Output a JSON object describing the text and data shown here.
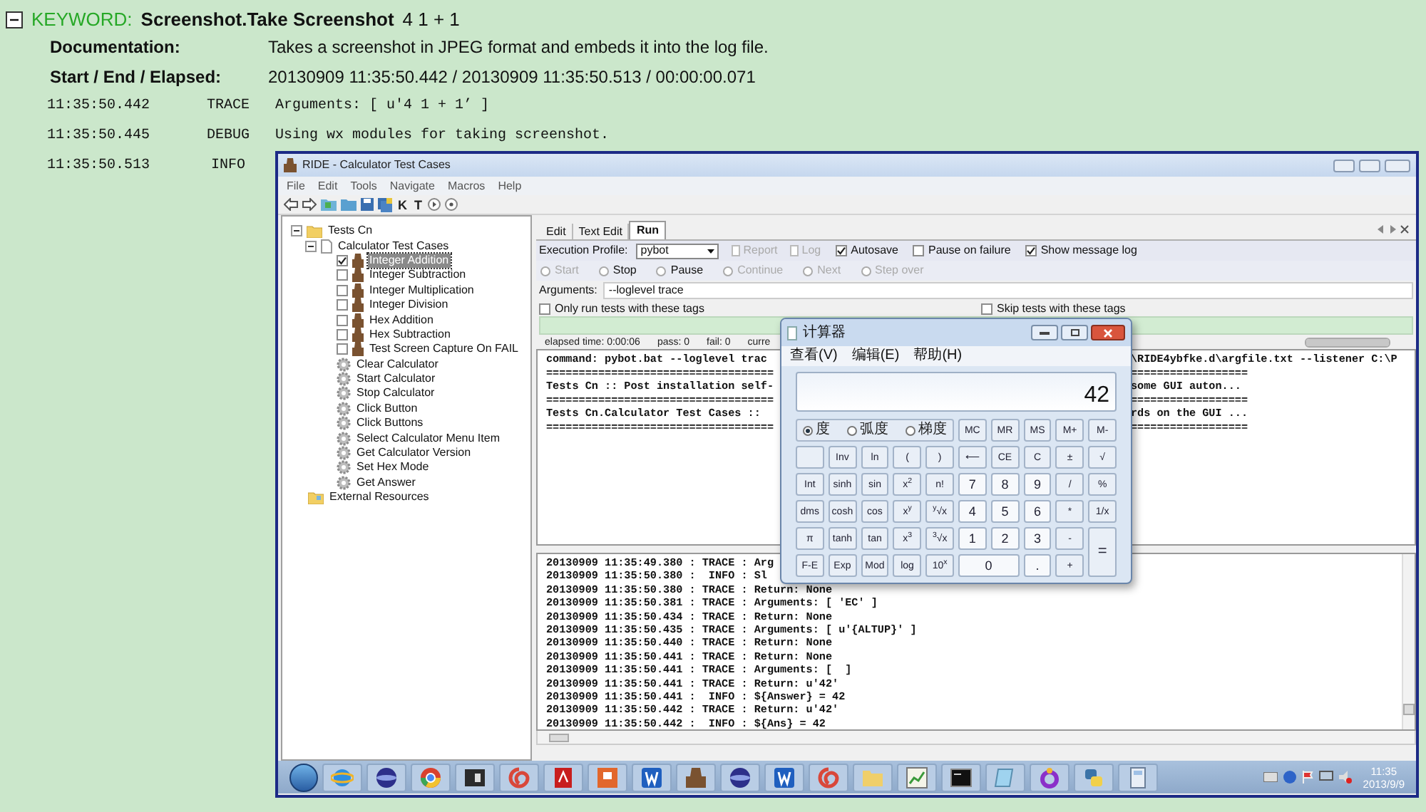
{
  "keyword": {
    "label": "KEYWORD:",
    "name": "Screenshot.Take Screenshot",
    "args": "4 1 + 1",
    "expanded": true
  },
  "details": [
    {
      "label": "Documentation:",
      "value": "Takes a screenshot in JPEG format and embeds it into the log file."
    },
    {
      "label": "Start / End / Elapsed:",
      "value": "20130909 11:35:50.442 / 20130909 11:35:50.513 / 00:00:00.071"
    }
  ],
  "messages": [
    {
      "time": "11:35:50.442",
      "level": "TRACE",
      "kind": "text",
      "text": "Arguments: [ u'4 1 + 1’ ]"
    },
    {
      "time": "11:35:50.445",
      "level": "DEBUG",
      "kind": "text",
      "text": "Using wx modules for taking screenshot."
    },
    {
      "time": "11:35:50.513",
      "level": "INFO",
      "kind": "screenshot"
    }
  ],
  "screenshot": {
    "window_title": "RIDE - Calculator Test Cases",
    "menu": [
      "File",
      "Edit",
      "Tools",
      "Navigate",
      "Macros",
      "Help"
    ],
    "toolbar": [
      {
        "kind": "back"
      },
      {
        "kind": "forward"
      },
      {
        "kind": "open-suite"
      },
      {
        "kind": "folder"
      },
      {
        "kind": "save"
      },
      {
        "kind": "save-all"
      },
      {
        "kind": "letter",
        "glyph": "K"
      },
      {
        "kind": "letter",
        "glyph": "T"
      },
      {
        "kind": "play"
      },
      {
        "kind": "stop"
      }
    ],
    "tree": [
      {
        "label": "Tests Cn",
        "kind": "folder",
        "expanded": true,
        "selected": false,
        "children": [
          {
            "label": "Calculator Test Cases",
            "kind": "file",
            "expanded": true,
            "selected": false,
            "children": [
              {
                "label": "Integer Addition",
                "kind": "test",
                "checked": true,
                "selected": true
              },
              {
                "label": "Integer Subtraction",
                "kind": "test",
                "checked": false,
                "selected": false
              },
              {
                "label": "Integer Multiplication",
                "kind": "test",
                "checked": false,
                "selected": false
              },
              {
                "label": "Integer Division",
                "kind": "test",
                "checked": false,
                "selected": false
              },
              {
                "label": "Hex Addition",
                "kind": "test",
                "checked": false,
                "selected": false
              },
              {
                "label": "Hex Subtraction",
                "kind": "test",
                "checked": false,
                "selected": false
              },
              {
                "label": "Test Screen Capture On FAIL",
                "kind": "test",
                "checked": false,
                "selected": false
              },
              {
                "label": "Clear Calculator",
                "kind": "keyword",
                "selected": false
              },
              {
                "label": "Start Calculator",
                "kind": "keyword",
                "selected": false
              },
              {
                "label": "Stop Calculator",
                "kind": "keyword",
                "selected": false
              },
              {
                "label": "Click Button",
                "kind": "keyword",
                "selected": false
              },
              {
                "label": "Click Buttons",
                "kind": "keyword",
                "selected": false
              },
              {
                "label": "Select Calculator Menu Item",
                "kind": "keyword",
                "selected": false
              },
              {
                "label": "Get Calculator Version",
                "kind": "keyword",
                "selected": false
              },
              {
                "label": "Set Hex Mode",
                "kind": "keyword",
                "selected": false
              },
              {
                "label": "Get Answer",
                "kind": "keyword",
                "selected": false
              }
            ]
          }
        ]
      },
      {
        "label": "External Resources",
        "kind": "resource",
        "selected": false
      }
    ],
    "tabs": [
      {
        "label": "Edit",
        "selected": false
      },
      {
        "label": "Text Edit",
        "selected": false
      },
      {
        "label": "Run",
        "selected": true
      }
    ],
    "profile": {
      "label": "Execution Profile:",
      "value": "pybot"
    },
    "reports": [
      {
        "label": "Report",
        "disabled": true
      },
      {
        "label": "Log",
        "disabled": true
      }
    ],
    "options": [
      {
        "label": "Autosave",
        "checked": true
      },
      {
        "label": "Pause on failure",
        "checked": false
      },
      {
        "label": "Show message log",
        "checked": true
      }
    ],
    "controls": [
      {
        "label": "Start",
        "disabled": true
      },
      {
        "label": "Stop",
        "disabled": false
      },
      {
        "label": "Pause",
        "disabled": false
      },
      {
        "label": "Continue",
        "disabled": true
      },
      {
        "label": "Next",
        "disabled": true
      },
      {
        "label": "Step over",
        "disabled": true
      }
    ],
    "arguments": {
      "label": "Arguments:",
      "value": "--loglevel trace"
    },
    "tag_filters": [
      {
        "label": "Only run tests with these tags",
        "checked": false
      },
      {
        "label": "Skip tests with these tags",
        "checked": false
      }
    ],
    "status": [
      "elapsed time: 0:00:06",
      "pass: 0",
      "fail: 0",
      "curre"
    ],
    "progress": {
      "level": 1
    },
    "console": [
      {
        "left": "command: pybot.bat --loglevel trac",
        "right": "\\RIDE4ybfke.d\\argfile.txt --listener C:\\P"
      },
      {
        "left": "===================================",
        "right": "=================="
      },
      {
        "left": "Tests Cn :: Post installation self-",
        "right": "some GUI auton..."
      },
      {
        "left": "===================================",
        "right": "=================="
      },
      {
        "left": "Tests Cn.Calculator Test Cases ::",
        "right": "rds on the GUI ..."
      },
      {
        "left": "===================================",
        "right": "=================="
      }
    ],
    "message_log": [
      "20130909 11:35:49.380 : TRACE : Arg",
      "20130909 11:35:50.380 :  INFO : Sl",
      "20130909 11:35:50.380 : TRACE : Return: None",
      "20130909 11:35:50.381 : TRACE : Arguments: [ 'EC' ]",
      "20130909 11:35:50.434 : TRACE : Return: None",
      "20130909 11:35:50.435 : TRACE : Arguments: [ u'{ALTUP}' ]",
      "20130909 11:35:50.440 : TRACE : Return: None",
      "20130909 11:35:50.441 : TRACE : Return: None",
      "20130909 11:35:50.441 : TRACE : Arguments: [  ]",
      "20130909 11:35:50.441 : TRACE : Return: u'42'",
      "20130909 11:35:50.441 :  INFO : ${Answer} = 42",
      "20130909 11:35:50.442 : TRACE : Return: u'42'",
      "20130909 11:35:50.442 :  INFO : ${Ans} = 42"
    ],
    "calculator": {
      "title": "计算器",
      "menu": [
        "查看(V)",
        "编辑(E)",
        "帮助(H)"
      ],
      "display": "42",
      "angle_modes": [
        {
          "label": "度",
          "selected": true
        },
        {
          "label": "弧度",
          "selected": false
        },
        {
          "label": "梯度",
          "selected": false
        }
      ],
      "keys": [
        {
          "label": "MC",
          "kind": "func"
        },
        {
          "label": "MR",
          "kind": "func"
        },
        {
          "label": "MS",
          "kind": "func"
        },
        {
          "label": "M+",
          "kind": "func"
        },
        {
          "label": "M-",
          "kind": "func"
        },
        {
          "kind": "blank"
        },
        {
          "label": "Inv",
          "kind": "func"
        },
        {
          "label": "ln",
          "kind": "func"
        },
        {
          "label": "(",
          "kind": "func"
        },
        {
          "label": ")",
          "kind": "func"
        },
        {
          "label": "⟵",
          "kind": "func"
        },
        {
          "label": "CE",
          "kind": "func"
        },
        {
          "label": "C",
          "kind": "func"
        },
        {
          "label": "±",
          "kind": "func"
        },
        {
          "label": "√",
          "kind": "func"
        },
        {
          "label": "Int",
          "kind": "func"
        },
        {
          "label": "sinh",
          "kind": "func"
        },
        {
          "label": "sin",
          "kind": "func"
        },
        {
          "label": "x$^{2}$",
          "kind": "func"
        },
        {
          "label": "n!",
          "kind": "func"
        },
        {
          "label": "7",
          "kind": "digit"
        },
        {
          "label": "8",
          "kind": "digit"
        },
        {
          "label": "9",
          "kind": "digit"
        },
        {
          "label": "/",
          "kind": "func"
        },
        {
          "label": "%",
          "kind": "func"
        },
        {
          "label": "dms",
          "kind": "func"
        },
        {
          "label": "cosh",
          "kind": "func"
        },
        {
          "label": "cos",
          "kind": "func"
        },
        {
          "label": "x$^{y}$",
          "kind": "func"
        },
        {
          "label": "$^{y}$√x",
          "kind": "func"
        },
        {
          "label": "4",
          "kind": "digit"
        },
        {
          "label": "5",
          "kind": "digit"
        },
        {
          "label": "6",
          "kind": "digit"
        },
        {
          "label": "*",
          "kind": "func"
        },
        {
          "label": "1/x",
          "kind": "func"
        },
        {
          "label": "π",
          "kind": "func"
        },
        {
          "label": "tanh",
          "kind": "func"
        },
        {
          "label": "tan",
          "kind": "func"
        },
        {
          "label": "x$^{3}$",
          "kind": "func"
        },
        {
          "label": "$^{3}$√x",
          "kind": "func"
        },
        {
          "label": "1",
          "kind": "digit"
        },
        {
          "label": "2",
          "kind": "digit"
        },
        {
          "label": "3",
          "kind": "digit"
        },
        {
          "label": "-",
          "kind": "func"
        },
        {
          "label": "=",
          "kind": "equals"
        },
        {
          "label": "F-E",
          "kind": "func"
        },
        {
          "label": "Exp",
          "kind": "func"
        },
        {
          "label": "Mod",
          "kind": "func"
        },
        {
          "label": "log",
          "kind": "func"
        },
        {
          "label": "10$^{x}$",
          "kind": "func"
        },
        {
          "label": "0",
          "kind": "zero"
        },
        {
          "label": ".",
          "kind": "digit"
        },
        {
          "label": "+",
          "kind": "func"
        }
      ]
    },
    "taskbar": {
      "time": "11:35",
      "date": "2013/9/9"
    }
  }
}
